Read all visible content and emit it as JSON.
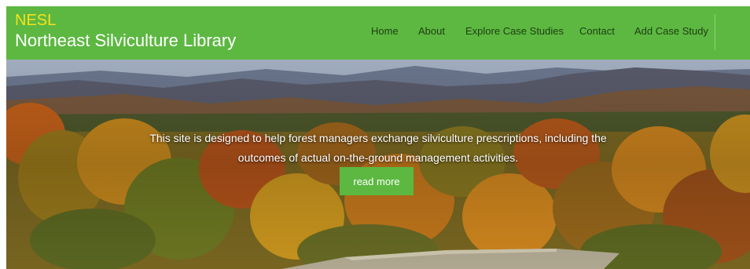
{
  "brand": {
    "short_name": "NESL",
    "full_name": "Northeast Silviculture Library"
  },
  "nav": {
    "items": [
      {
        "label": "Home"
      },
      {
        "label": "About"
      },
      {
        "label": "Explore Case Studies"
      },
      {
        "label": "Contact"
      },
      {
        "label": "Add Case Study"
      }
    ]
  },
  "hero": {
    "line1": "This site is designed to help forest managers exchange silviculture prescriptions, including the",
    "line2": "outcomes of actual on-the-ground management activities.",
    "button_label": "read more"
  },
  "colors": {
    "header_bg": "#5cb841",
    "brand_accent": "#f5e21b",
    "nav_text": "#1f3d12",
    "button_bg": "#5cb841"
  }
}
